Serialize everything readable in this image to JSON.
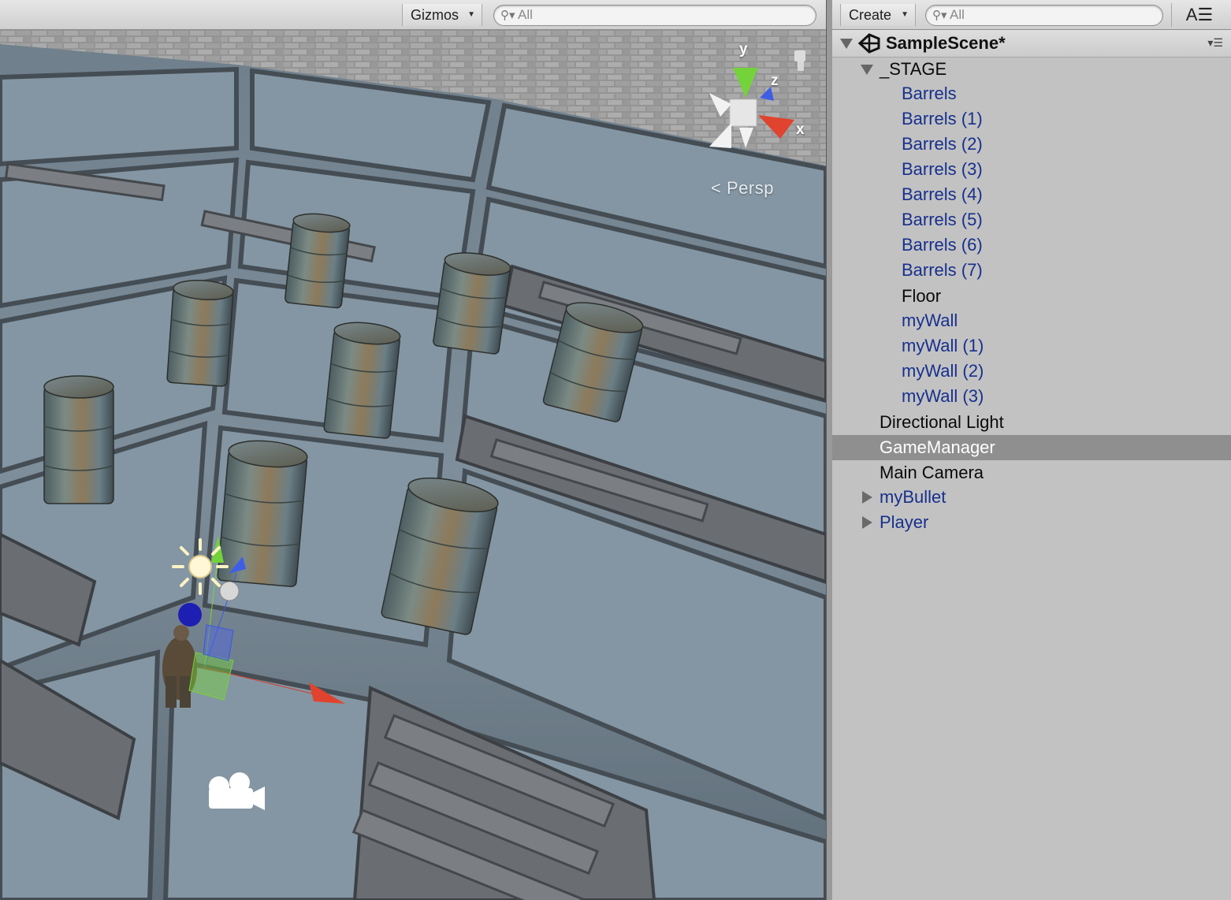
{
  "scene_view": {
    "toolbar": {
      "gizmos_label": "Gizmos",
      "search_placeholder": "All"
    },
    "projection_label": "Persp",
    "axis_labels": {
      "y": "y",
      "z": "z",
      "x": "x"
    }
  },
  "hierarchy": {
    "toolbar": {
      "create_label": "Create",
      "search_placeholder": "All"
    },
    "scene_name": "SampleScene*",
    "rows": [
      {
        "label": "_STAGE",
        "color": "black",
        "expander": "expanded"
      },
      {
        "label": "Barrels",
        "color": "blue"
      },
      {
        "label": "Barrels (1)",
        "color": "blue"
      },
      {
        "label": "Barrels (2)",
        "color": "blue"
      },
      {
        "label": "Barrels (3)",
        "color": "blue"
      },
      {
        "label": "Barrels (4)",
        "color": "blue"
      },
      {
        "label": "Barrels (5)",
        "color": "blue"
      },
      {
        "label": "Barrels (6)",
        "color": "blue"
      },
      {
        "label": "Barrels (7)",
        "color": "blue"
      },
      {
        "label": "Floor",
        "color": "black"
      },
      {
        "label": "myWall",
        "color": "blue"
      },
      {
        "label": "myWall (1)",
        "color": "blue"
      },
      {
        "label": "myWall (2)",
        "color": "blue"
      },
      {
        "label": "myWall (3)",
        "color": "blue"
      },
      {
        "label": "Directional Light",
        "color": "black"
      },
      {
        "label": "GameManager",
        "color": "white",
        "selected": true
      },
      {
        "label": "Main Camera",
        "color": "black"
      },
      {
        "label": "myBullet",
        "color": "blue",
        "expander": "collapsed"
      },
      {
        "label": "Player",
        "color": "blue",
        "expander": "collapsed"
      }
    ]
  },
  "colors": {
    "prefab_blue": "#17308e",
    "selection_gray": "#8f8f8f",
    "panel_bg": "#c2c2c2"
  }
}
